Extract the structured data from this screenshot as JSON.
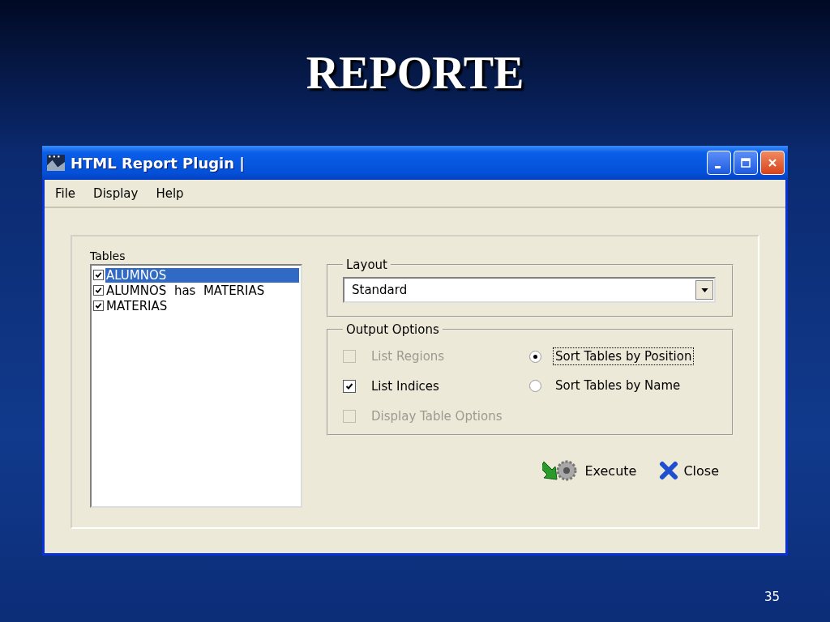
{
  "slide": {
    "title": "REPORTE",
    "page_number": "35"
  },
  "window": {
    "title": "HTML Report Plugin |"
  },
  "menu": [
    {
      "label": "File"
    },
    {
      "label": "Display"
    },
    {
      "label": "Help"
    }
  ],
  "tables": {
    "label": "Tables",
    "items": [
      {
        "label": "ALUMNOS",
        "checked": true,
        "selected": true
      },
      {
        "label": "ALUMNOS  has  MATERIAS",
        "checked": true,
        "selected": false
      },
      {
        "label": "MATERIAS",
        "checked": true,
        "selected": false
      }
    ]
  },
  "layout": {
    "label": "Layout",
    "value": "Standard"
  },
  "output_options": {
    "label": "Output Options",
    "options": [
      {
        "kind": "checkbox",
        "label": "List Regions",
        "checked": false,
        "disabled": true,
        "focused": false
      },
      {
        "kind": "radio",
        "label": "Sort Tables by Position",
        "checked": true,
        "disabled": false,
        "focused": true
      },
      {
        "kind": "checkbox",
        "label": "List Indices",
        "checked": true,
        "disabled": false,
        "focused": false
      },
      {
        "kind": "radio",
        "label": "Sort Tables by Name",
        "checked": false,
        "disabled": false,
        "focused": false
      },
      {
        "kind": "checkbox",
        "label": "Display Table Options",
        "checked": false,
        "disabled": true,
        "focused": false
      }
    ]
  },
  "buttons": [
    {
      "kind": "execute",
      "label": "Execute"
    },
    {
      "kind": "close",
      "label": "Close"
    }
  ]
}
